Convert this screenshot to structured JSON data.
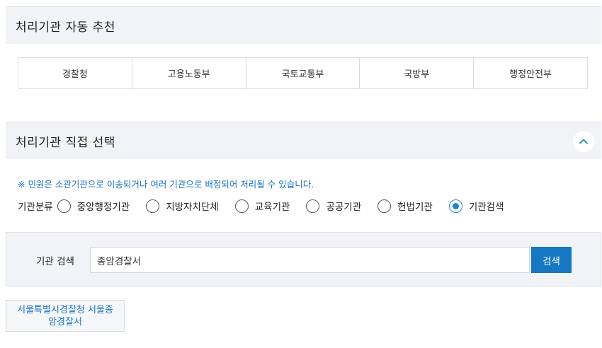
{
  "auto_section": {
    "title": "처리기관 자동 추천",
    "agencies": [
      "경찰청",
      "고용노동부",
      "국토교통부",
      "국방부",
      "행정안전부"
    ]
  },
  "direct_section": {
    "title": "처리기관 직접 선택",
    "collapse_icon": "chevron-up-icon",
    "notice": "※ 민원은 소관기관으로 이송되거나 여러 기관으로 배정되어 처리될 수 있습니다.",
    "classify_label": "기관분류",
    "options": [
      {
        "label": "중앙행정기관",
        "checked": false
      },
      {
        "label": "지방자치단체",
        "checked": false
      },
      {
        "label": "교육기관",
        "checked": false
      },
      {
        "label": "공공기관",
        "checked": false
      },
      {
        "label": "헌법기관",
        "checked": false
      },
      {
        "label": "기관검색",
        "checked": true
      }
    ]
  },
  "search": {
    "label": "기관 검색",
    "value": "종암경찰서",
    "button_label": "검색"
  },
  "results": [
    {
      "label": "서울특별시경찰청 서울종암경찰서"
    }
  ],
  "colors": {
    "accent": "#1677c2",
    "link_text": "#1a73c7",
    "section_bg": "#f1f3f6"
  }
}
